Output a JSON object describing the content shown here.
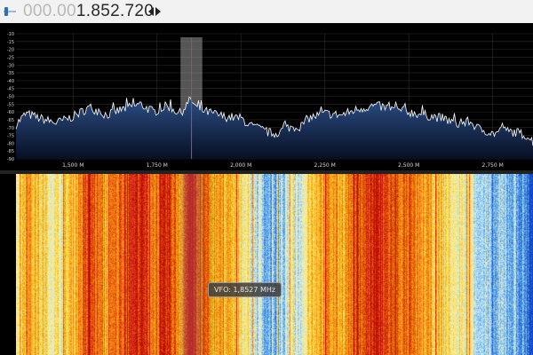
{
  "frequency_display": {
    "dim_digits": "000.00",
    "main_digits": "1.852.720"
  },
  "vfo_tooltip": "VFO: 1,8527 MHz",
  "colors": {
    "spectrum_fill_top": "#2c4f86",
    "spectrum_fill_bottom": "#070f24",
    "spectrum_line": "#ffffff",
    "vfo_line": "#ff2a2a",
    "vfo_band": "#9a9a9a"
  },
  "chart_data": {
    "type": "area",
    "xlabel": "",
    "ylabel": "",
    "x_range_mhz": [
      1.33,
      2.87
    ],
    "ylim": [
      -90,
      -10
    ],
    "y_ticks": [
      -10,
      -15,
      -20,
      -25,
      -30,
      -35,
      -40,
      -45,
      -50,
      -55,
      -60,
      -65,
      -70,
      -75,
      -80,
      -85,
      -90
    ],
    "x_tick_values": [
      1.5,
      1.75,
      2.0,
      2.25,
      2.5,
      2.75
    ],
    "x_tick_labels": [
      "1,500 M",
      "1,750 M",
      "2,000 M",
      "2,250 M",
      "2,500 M",
      "2,750 M"
    ],
    "grid": true,
    "vfo_frequency_mhz": 1.8527,
    "vfo_bandwidth_mhz": [
      1.82,
      1.885
    ],
    "envelope": {
      "x": [
        1.33,
        1.36,
        1.4,
        1.45,
        1.5,
        1.55,
        1.6,
        1.65,
        1.7,
        1.74,
        1.78,
        1.82,
        1.85,
        1.87,
        1.9,
        1.95,
        2.0,
        2.03,
        2.06,
        2.08,
        2.1,
        2.14,
        2.18,
        2.2,
        2.25,
        2.3,
        2.35,
        2.4,
        2.45,
        2.5,
        2.55,
        2.6,
        2.65,
        2.68,
        2.71,
        2.73,
        2.75,
        2.78,
        2.82,
        2.85,
        2.87
      ],
      "y": [
        -68,
        -61,
        -64,
        -67,
        -63,
        -57,
        -62,
        -58,
        -55,
        -60,
        -56,
        -61,
        -52,
        -58,
        -60,
        -63,
        -64,
        -69,
        -71,
        -73,
        -74,
        -70,
        -69,
        -64,
        -61,
        -62,
        -58,
        -56,
        -58,
        -60,
        -62,
        -64,
        -68,
        -66,
        -71,
        -72,
        -74,
        -72,
        -73,
        -75,
        -79
      ]
    }
  }
}
